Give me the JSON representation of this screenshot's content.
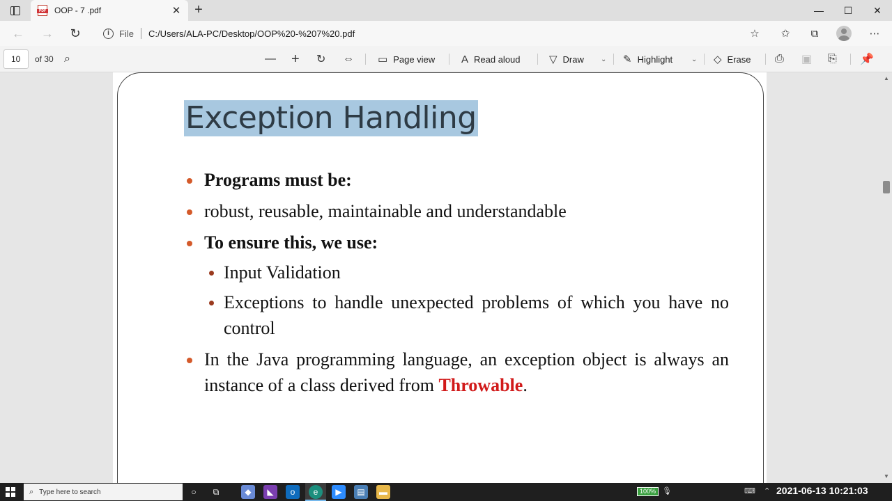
{
  "tab": {
    "title": "OOP - 7 .pdf",
    "close": "✕",
    "new_tab": "+"
  },
  "window": {
    "minimize": "—",
    "maximize": "☐",
    "close": "✕"
  },
  "address": {
    "file_label": "File",
    "url": "C:/Users/ALA-PC/Desktop/OOP%20-%207%20.pdf"
  },
  "pdf_toolbar": {
    "current_page": "10",
    "of_pages": "of 30",
    "page_view": "Page view",
    "read_aloud": "Read aloud",
    "draw": "Draw",
    "highlight": "Highlight",
    "erase": "Erase"
  },
  "slide": {
    "title": "Exception Handling",
    "bullets": {
      "b1": "Programs must be:",
      "b2": "robust, reusable, maintainable and understandable",
      "b3": "To ensure this, we use:",
      "s1": "Input Validation",
      "s2": "Exceptions to handle unexpected problems of which you have no control",
      "b4_prefix": "In the Java programming language, an exception object is always an instance of a class derived from ",
      "b4_emph": "Throwable",
      "b4_suffix": "."
    }
  },
  "taskbar": {
    "search_placeholder": "Type here to search",
    "battery": "100%",
    "clock": "2021-06-13  10:21:03"
  },
  "colors": {
    "title_highlight": "#a8c8e0",
    "bullet": "#d45a2a",
    "throwable": "#d11a1a",
    "accent": "#0078d4"
  }
}
